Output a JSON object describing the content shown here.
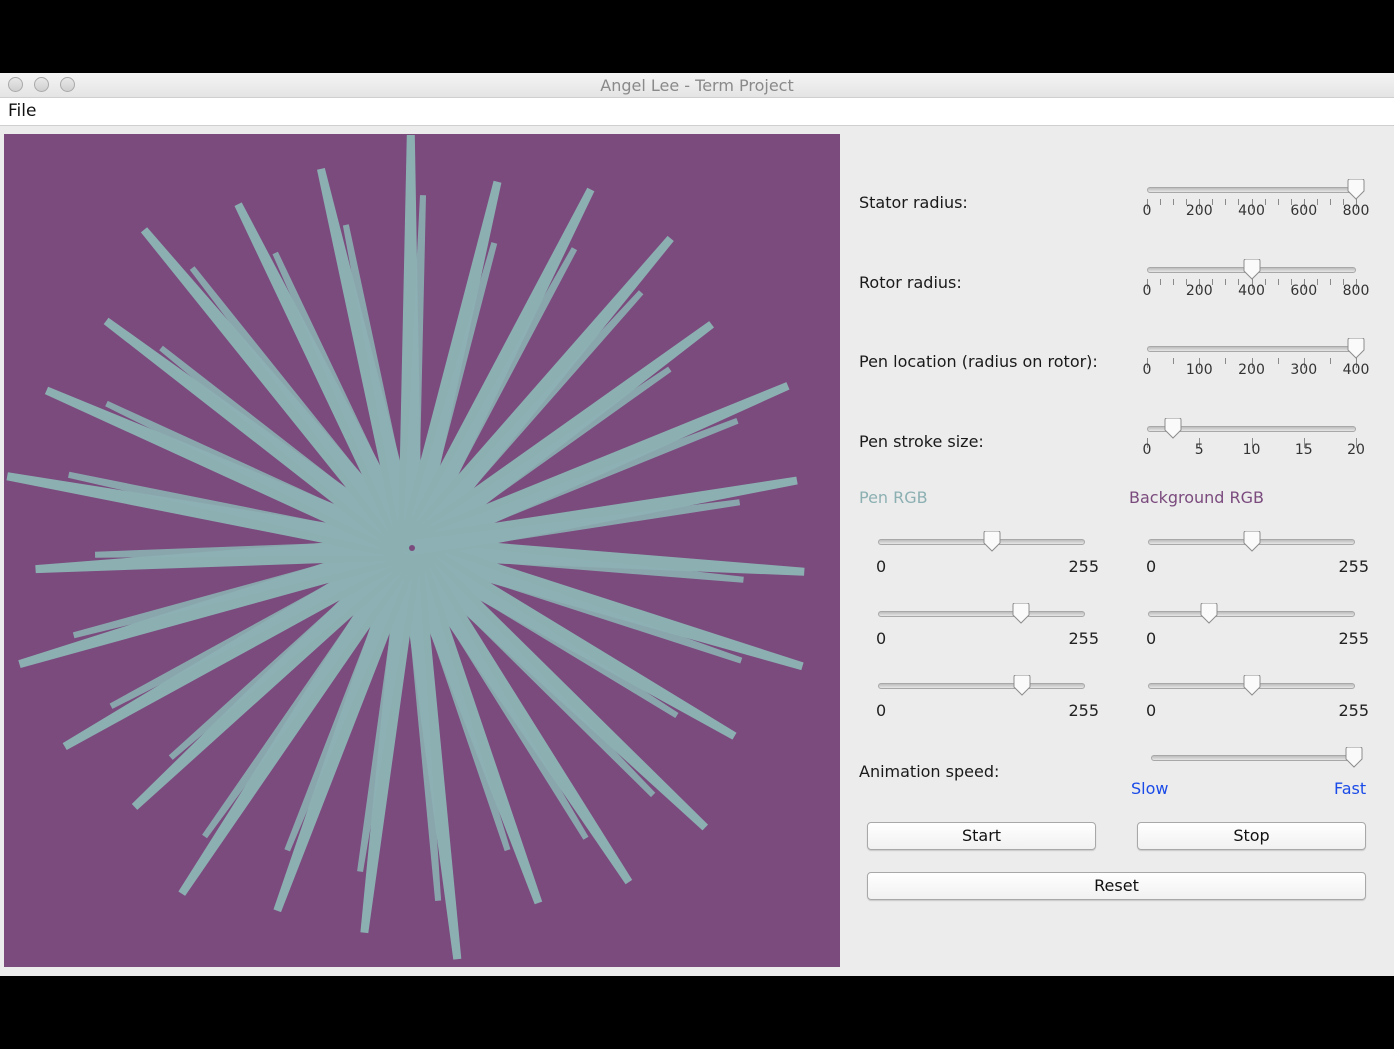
{
  "window": {
    "title": "Angel Lee - Term Project"
  },
  "menu": {
    "file": "File"
  },
  "controls": {
    "stator": {
      "label": "Stator radius:",
      "ticks": [
        "0",
        "200",
        "400",
        "600",
        "800"
      ],
      "value": 800,
      "max": 800
    },
    "rotor": {
      "label": "Rotor radius:",
      "ticks": [
        "0",
        "200",
        "400",
        "600",
        "800"
      ],
      "value": 400,
      "max": 800
    },
    "pen_location": {
      "label": "Pen location (radius on rotor):",
      "ticks": [
        "0",
        "100",
        "200",
        "300",
        "400"
      ],
      "value": 400,
      "max": 400
    },
    "stroke": {
      "label": "Pen stroke size:",
      "ticks": [
        "0",
        "5",
        "10",
        "15",
        "20"
      ],
      "value": 2.5,
      "max": 20
    },
    "pen_rgb": {
      "label": "Pen RGB",
      "color": "#8cb0b2",
      "min": "0",
      "max": "255",
      "values": [
        140,
        176,
        178
      ]
    },
    "bg_rgb": {
      "label": "Background RGB",
      "color": "#7b4b7e",
      "min": "0",
      "max": "255",
      "values": [
        128,
        75,
        128
      ]
    },
    "speed": {
      "label": "Animation speed:",
      "slow": "Slow",
      "fast": "Fast",
      "value": 1.0
    }
  },
  "buttons": {
    "start": "Start",
    "stop": "Stop",
    "reset": "Reset"
  },
  "colors": {
    "canvas_bg": "#7b4b7e",
    "pen": "#8cb0b2",
    "speed_labels": "#1a4be8"
  }
}
